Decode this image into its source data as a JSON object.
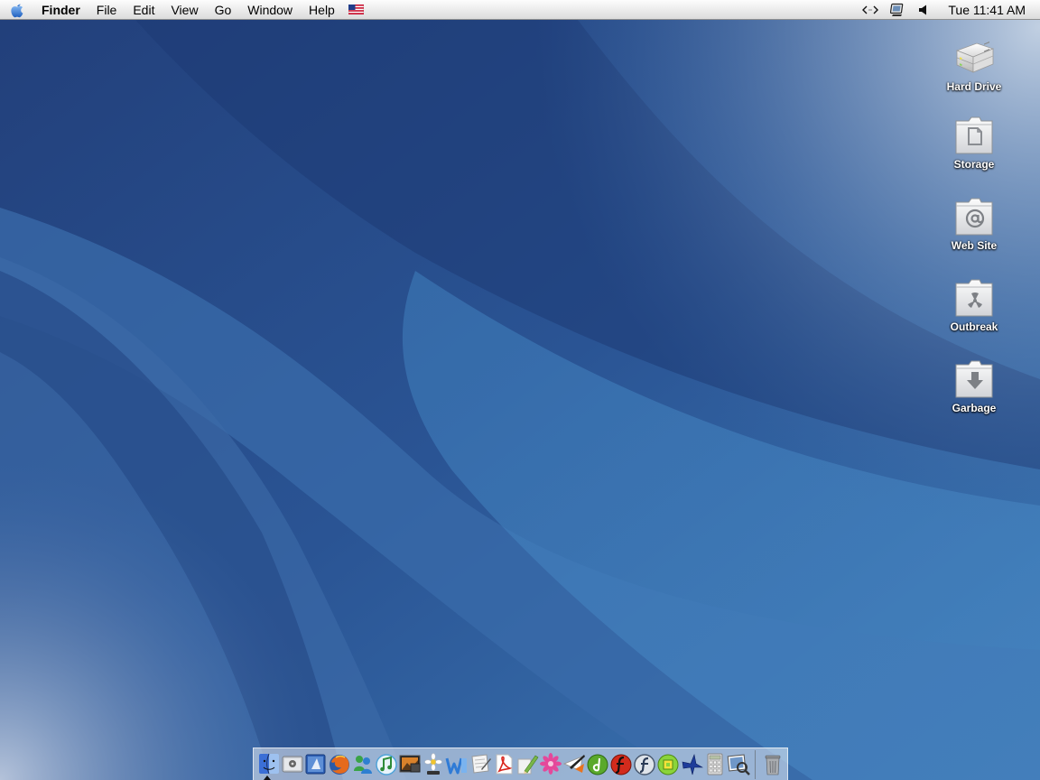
{
  "menubar": {
    "apple_icon": "apple-logo-icon",
    "app_name": "Finder",
    "menus": [
      "File",
      "Edit",
      "View",
      "Go",
      "Window",
      "Help"
    ],
    "input_flag_icon": "us-flag-icon",
    "extras": [
      "script-menu-icon",
      "display-menu-icon",
      "volume-icon"
    ],
    "clock": "Tue 11:41 AM"
  },
  "desktop_icons": [
    {
      "label": "Hard Drive",
      "icon": "hard-drive-icon"
    },
    {
      "label": "Storage",
      "icon": "document-folder-icon"
    },
    {
      "label": "Web Site",
      "icon": "at-sign-folder-icon"
    },
    {
      "label": "Outbreak",
      "icon": "radiation-folder-icon"
    },
    {
      "label": "Garbage",
      "icon": "download-folder-icon"
    }
  ],
  "dock": {
    "items": [
      "finder-icon",
      "system-preferences-icon",
      "safari-icon",
      "firefox-icon",
      "messenger-icon",
      "itunes-icon",
      "iphoto-icon",
      "flower-utility-icon",
      "word-icon",
      "textedit-icon",
      "acrobat-icon",
      "pencil-app-icon",
      "flower-app-icon",
      "fireworks-app-icon",
      "dreamweaver-icon",
      "director-icon",
      "flash-icon",
      "green-square-app-icon",
      "blue-bird-app-icon",
      "calculator-icon",
      "preview-icon"
    ],
    "trash_icon": "trash-icon",
    "colors": {
      "finder": "#3b6fd6",
      "safari": "#1d64c8",
      "firefox": "#e56a1c",
      "itunes": "#4fa3d9",
      "acrobat": "#d9251c",
      "dreamweaver": "#5aa92b",
      "director": "#d32b1c",
      "flash": "#4a5a70"
    }
  }
}
